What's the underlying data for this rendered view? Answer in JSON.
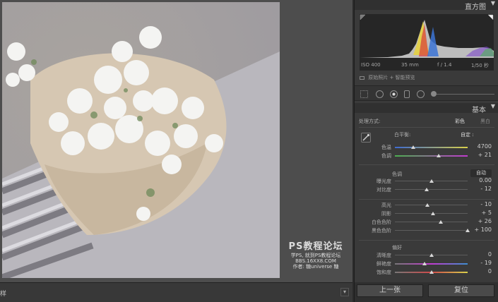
{
  "filmstrip": {
    "label": "样"
  },
  "watermark": {
    "title": "PS教程论坛",
    "line1": "学PS, 就到PS教程论坛",
    "line2": "BBS.16XX8.COM",
    "line3": "作者: 糖universe 糖"
  },
  "histogram": {
    "title": "直方图",
    "iso": "ISO 400",
    "focal": "35 mm",
    "aperture": "f / 1.4",
    "shutter": "1/50 秒",
    "original_preview": "原始照片 + 智能预览"
  },
  "basic": {
    "title": "基本",
    "treatment_label": "处理方式:",
    "treatment_color": "彩色",
    "treatment_bw": "黑白",
    "wb_label": "白平衡:",
    "wb_value": "自定 :",
    "temp_label": "色温",
    "temp_value": "4700",
    "tint_label": "色调",
    "tint_value": "+ 21",
    "tone_label": "色调",
    "auto_label": "自动",
    "exposure_label": "曝光度",
    "exposure_value": "0.00",
    "contrast_label": "对比度",
    "contrast_value": "- 12",
    "highlights_label": "高光",
    "highlights_value": "- 10",
    "shadows_label": "阴影",
    "shadows_value": "+ 5",
    "whites_label": "白色色阶",
    "whites_value": "+ 26",
    "blacks_label": "黑色色阶",
    "blacks_value": "+ 100",
    "presence_label": "偏好",
    "clarity_label": "清晰度",
    "clarity_value": "0",
    "vibrance_label": "鲜艳度",
    "vibrance_value": "- 19",
    "saturation_label": "饱和度",
    "saturation_value": "0"
  },
  "slider_levels": {
    "temp": 0.25,
    "tint": 0.6,
    "exposure": 0.5,
    "contrast": 0.44,
    "highlights": 0.45,
    "shadows": 0.52,
    "whites": 0.63,
    "blacks": 1.0,
    "clarity": 0.5,
    "vibrance": 0.41,
    "saturation": 0.5
  },
  "buttons": {
    "previous": "上一张",
    "reset": "复位"
  }
}
